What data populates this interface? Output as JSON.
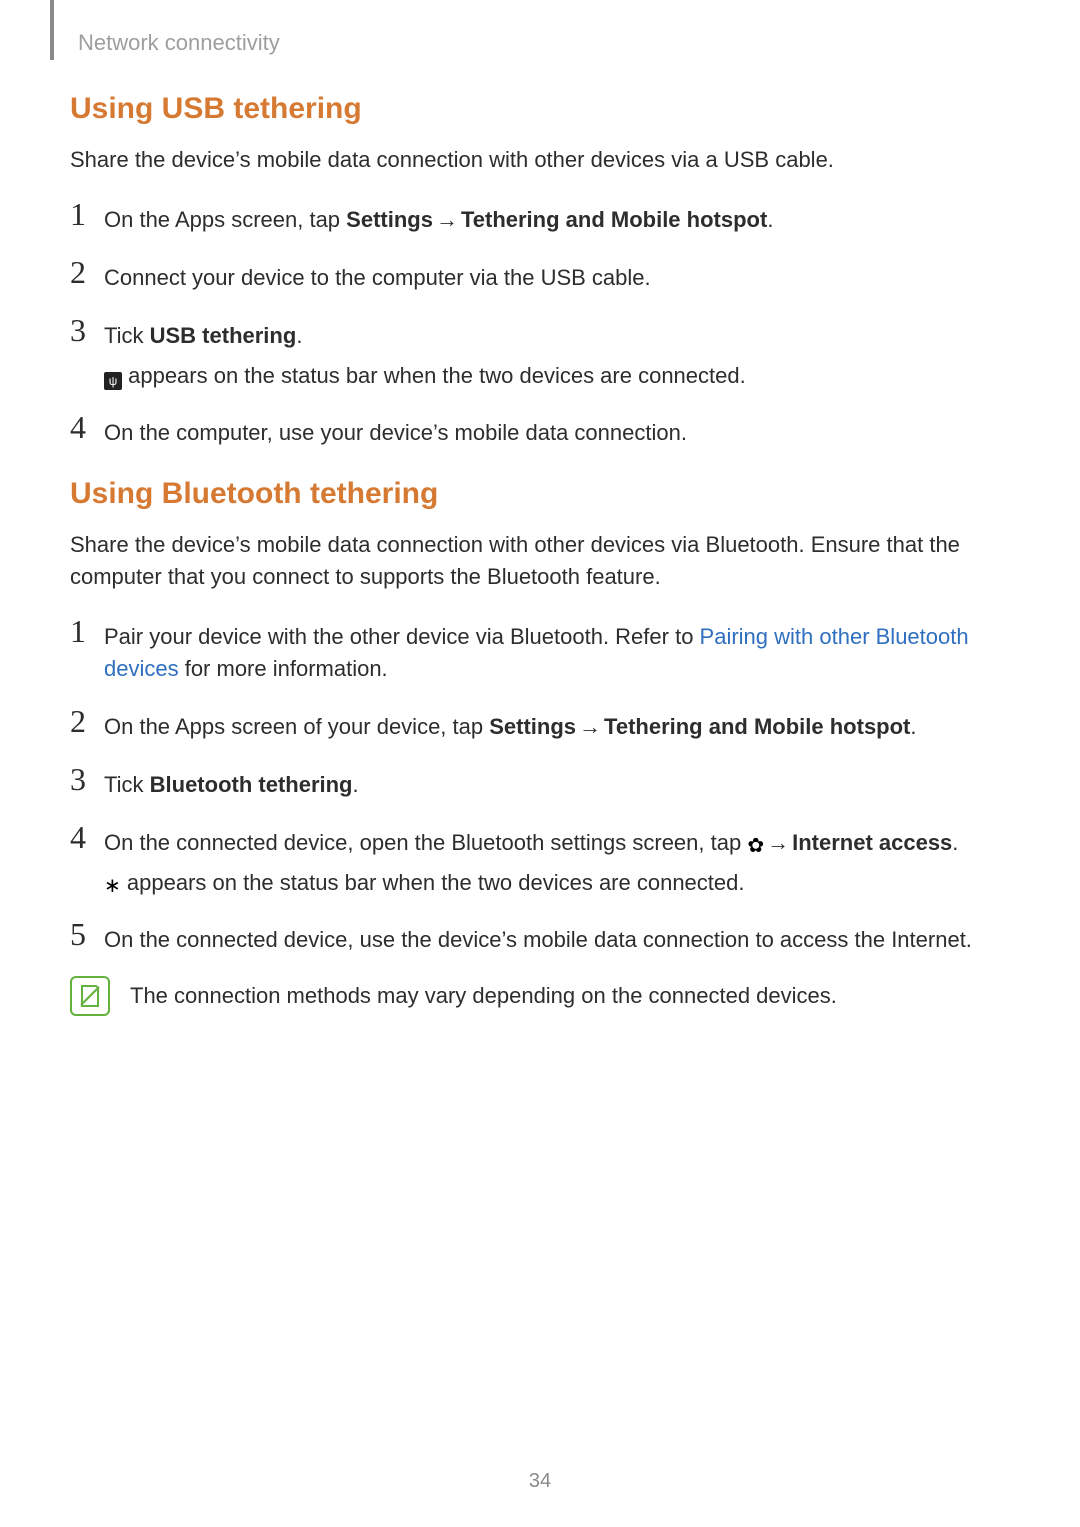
{
  "header": {
    "breadcrumb": "Network connectivity"
  },
  "page_number": "34",
  "section_usb": {
    "title": "Using USB tethering",
    "intro": "Share the device’s mobile data connection with other devices via a USB cable.",
    "steps": {
      "s1": {
        "num": "1",
        "pre": "On the Apps screen, tap ",
        "b1": "Settings",
        "arrow": " → ",
        "b2": "Tethering and Mobile hotspot",
        "post": "."
      },
      "s2": {
        "num": "2",
        "text": "Connect your device to the computer via the USB cable."
      },
      "s3": {
        "num": "3",
        "pre": "Tick ",
        "b1": "USB tethering",
        "post": ".",
        "sub_post": " appears on the status bar when the two devices are connected."
      },
      "s4": {
        "num": "4",
        "text": "On the computer, use your device’s mobile data connection."
      }
    }
  },
  "section_bt": {
    "title": "Using Bluetooth tethering",
    "intro": "Share the device’s mobile data connection with other devices via Bluetooth. Ensure that the computer that you connect to supports the Bluetooth feature.",
    "steps": {
      "s1": {
        "num": "1",
        "pre": "Pair your device with the other device via Bluetooth. Refer to ",
        "link": "Pairing with other Bluetooth devices",
        "post": " for more information."
      },
      "s2": {
        "num": "2",
        "pre": "On the Apps screen of your device, tap ",
        "b1": "Settings",
        "arrow": " → ",
        "b2": "Tethering and Mobile hotspot",
        "post": "."
      },
      "s3": {
        "num": "3",
        "pre": "Tick ",
        "b1": "Bluetooth tethering",
        "post": "."
      },
      "s4": {
        "num": "4",
        "pre": "On the connected device, open the Bluetooth settings screen, tap ",
        "arrow": " → ",
        "b1": "Internet access",
        "post": ".",
        "sub_post": " appears on the status bar when the two devices are connected."
      },
      "s5": {
        "num": "5",
        "text": "On the connected device, use the device’s mobile data connection to access the Internet."
      }
    },
    "note": "The connection methods may vary depending on the connected devices."
  },
  "glyphs": {
    "usb_tether_icon": "ψ",
    "gear_icon": "✿",
    "bt_tether_icon": "∗",
    "arrow": "→"
  }
}
